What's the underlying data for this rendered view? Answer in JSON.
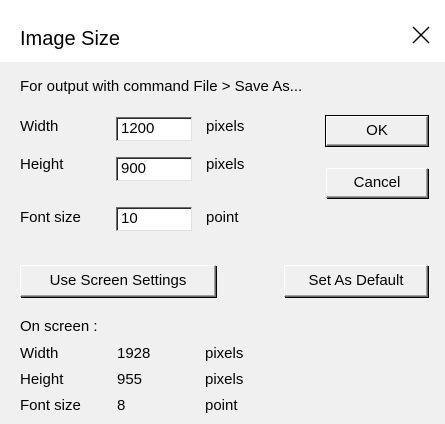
{
  "window": {
    "title": "Image Size"
  },
  "dialog": {
    "description": "For output with command File > Save As...",
    "width_label": "Width",
    "width_value": "1200",
    "width_unit": "pixels",
    "height_label": "Height",
    "height_value": "900",
    "height_unit": "pixels",
    "font_size_label": "Font size",
    "font_size_value": "10",
    "font_size_unit": "point"
  },
  "buttons": {
    "ok": "OK",
    "cancel": "Cancel",
    "use_screen_settings": "Use Screen Settings",
    "set_as_default": "Set As Default"
  },
  "screen_info": {
    "header": "On screen :",
    "rows": [
      {
        "label": "Width",
        "value": "1928",
        "unit": "pixels"
      },
      {
        "label": "Height",
        "value": "955",
        "unit": "pixels"
      },
      {
        "label": "Font size",
        "value": "8",
        "unit": "point"
      }
    ]
  },
  "icons": {
    "close": "close-icon"
  }
}
